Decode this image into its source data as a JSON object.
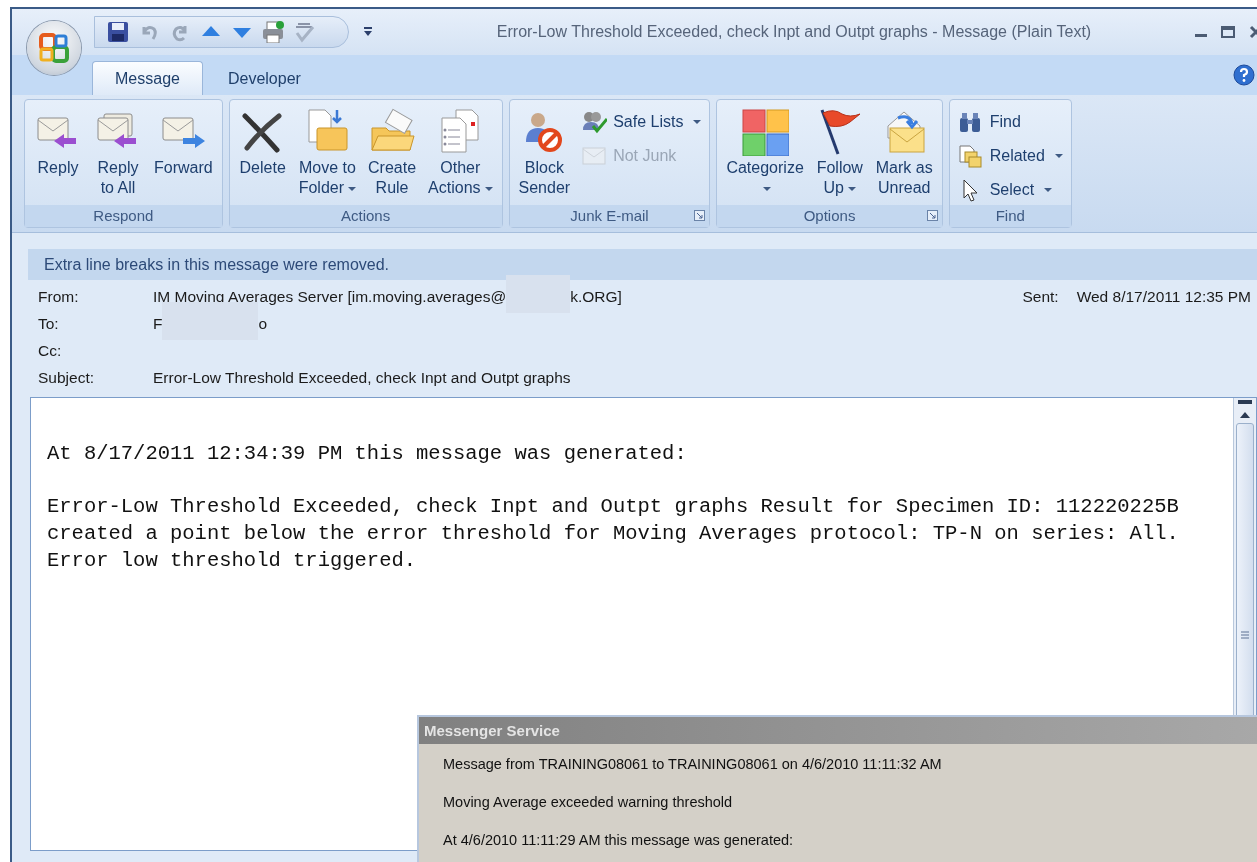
{
  "window": {
    "title": "Error-Low Threshold Exceeded, check Inpt and Outpt graphs  -  Message (Plain Text)"
  },
  "tabs": [
    {
      "label": "Message",
      "selected": true
    },
    {
      "label": "Developer",
      "selected": false
    }
  ],
  "ribbon": {
    "groups": [
      {
        "label": "Respond",
        "launcher": false,
        "buttons": [
          {
            "kind": "large",
            "lines": [
              "Reply"
            ],
            "dropdown": false,
            "disabled": false
          },
          {
            "kind": "large",
            "lines": [
              "Reply",
              "to All"
            ],
            "dropdown": false,
            "disabled": false
          },
          {
            "kind": "large",
            "lines": [
              "Forward"
            ],
            "dropdown": false,
            "disabled": false
          }
        ]
      },
      {
        "label": "Actions",
        "launcher": false,
        "buttons": [
          {
            "kind": "large",
            "lines": [
              "Delete"
            ],
            "dropdown": false,
            "disabled": false
          },
          {
            "kind": "large",
            "lines": [
              "Move to",
              "Folder"
            ],
            "dropdown": true,
            "disabled": false
          },
          {
            "kind": "large",
            "lines": [
              "Create",
              "Rule"
            ],
            "dropdown": false,
            "disabled": false
          },
          {
            "kind": "large",
            "lines": [
              "Other",
              "Actions"
            ],
            "dropdown": true,
            "disabled": false
          }
        ]
      },
      {
        "label": "Junk E-mail",
        "launcher": true,
        "buttons": [
          {
            "kind": "large",
            "lines": [
              "Block",
              "Sender"
            ],
            "dropdown": false,
            "disabled": false
          },
          {
            "kind": "small",
            "lines": [
              "Safe Lists"
            ],
            "dropdown": true,
            "disabled": false
          },
          {
            "kind": "small",
            "lines": [
              "Not Junk"
            ],
            "dropdown": false,
            "disabled": true
          }
        ]
      },
      {
        "label": "Options",
        "launcher": true,
        "buttons": [
          {
            "kind": "large",
            "lines": [
              "Categorize"
            ],
            "dropdown": true,
            "disabled": false
          },
          {
            "kind": "large",
            "lines": [
              "Follow",
              "Up"
            ],
            "dropdown": true,
            "disabled": false
          },
          {
            "kind": "large",
            "lines": [
              "Mark as",
              "Unread"
            ],
            "dropdown": false,
            "disabled": false
          }
        ]
      },
      {
        "label": "Find",
        "launcher": false,
        "buttons": [
          {
            "kind": "small",
            "lines": [
              "Find"
            ],
            "dropdown": false,
            "disabled": false
          },
          {
            "kind": "small",
            "lines": [
              "Related"
            ],
            "dropdown": true,
            "disabled": false
          },
          {
            "kind": "small",
            "lines": [
              "Select"
            ],
            "dropdown": true,
            "disabled": false
          }
        ]
      }
    ]
  },
  "info_bar": "Extra line breaks in this message were removed.",
  "headers": [
    {
      "label": "From:",
      "value": [
        {
          "kind": "text",
          "text": "IM Moving Averages Server [im.moving.averages@"
        },
        {
          "kind": "redacted"
        },
        {
          "kind": "text",
          "text": "k.ORG]"
        }
      ]
    },
    {
      "label": "To:",
      "value": [
        {
          "kind": "text",
          "text": "F"
        },
        {
          "kind": "redacted"
        },
        {
          "kind": "text",
          "text": "o"
        }
      ]
    },
    {
      "label": "Cc:"
    },
    {
      "label": "Subject:",
      "value": [
        {
          "kind": "text",
          "text": "Error-Low Threshold Exceeded, check Inpt and Outpt graphs"
        }
      ]
    }
  ],
  "sent": {
    "label": "Sent:",
    "value": "Wed 8/17/2011 12:35 PM"
  },
  "body": {
    "paragraphs": [
      [
        "At 8/17/2011 12:34:39 PM this message was generated:"
      ],
      [
        "Error-Low Threshold Exceeded, check Inpt and Outpt graphs Result for Specimen ID: 112220225B",
        "created a point below the error threshold for Moving Averages protocol: TP-N on series: All.",
        "Error low threshold triggered."
      ]
    ]
  },
  "messenger_dialog": {
    "title": "Messenger Service",
    "lines": [
      "Message from TRAINING08061 to TRAINING08061 on 4/6/2010 11:11:32 AM",
      "Moving Average exceeded warning threshold",
      "At 4/6/2010 11:11:29 AM this message was generated:"
    ]
  }
}
